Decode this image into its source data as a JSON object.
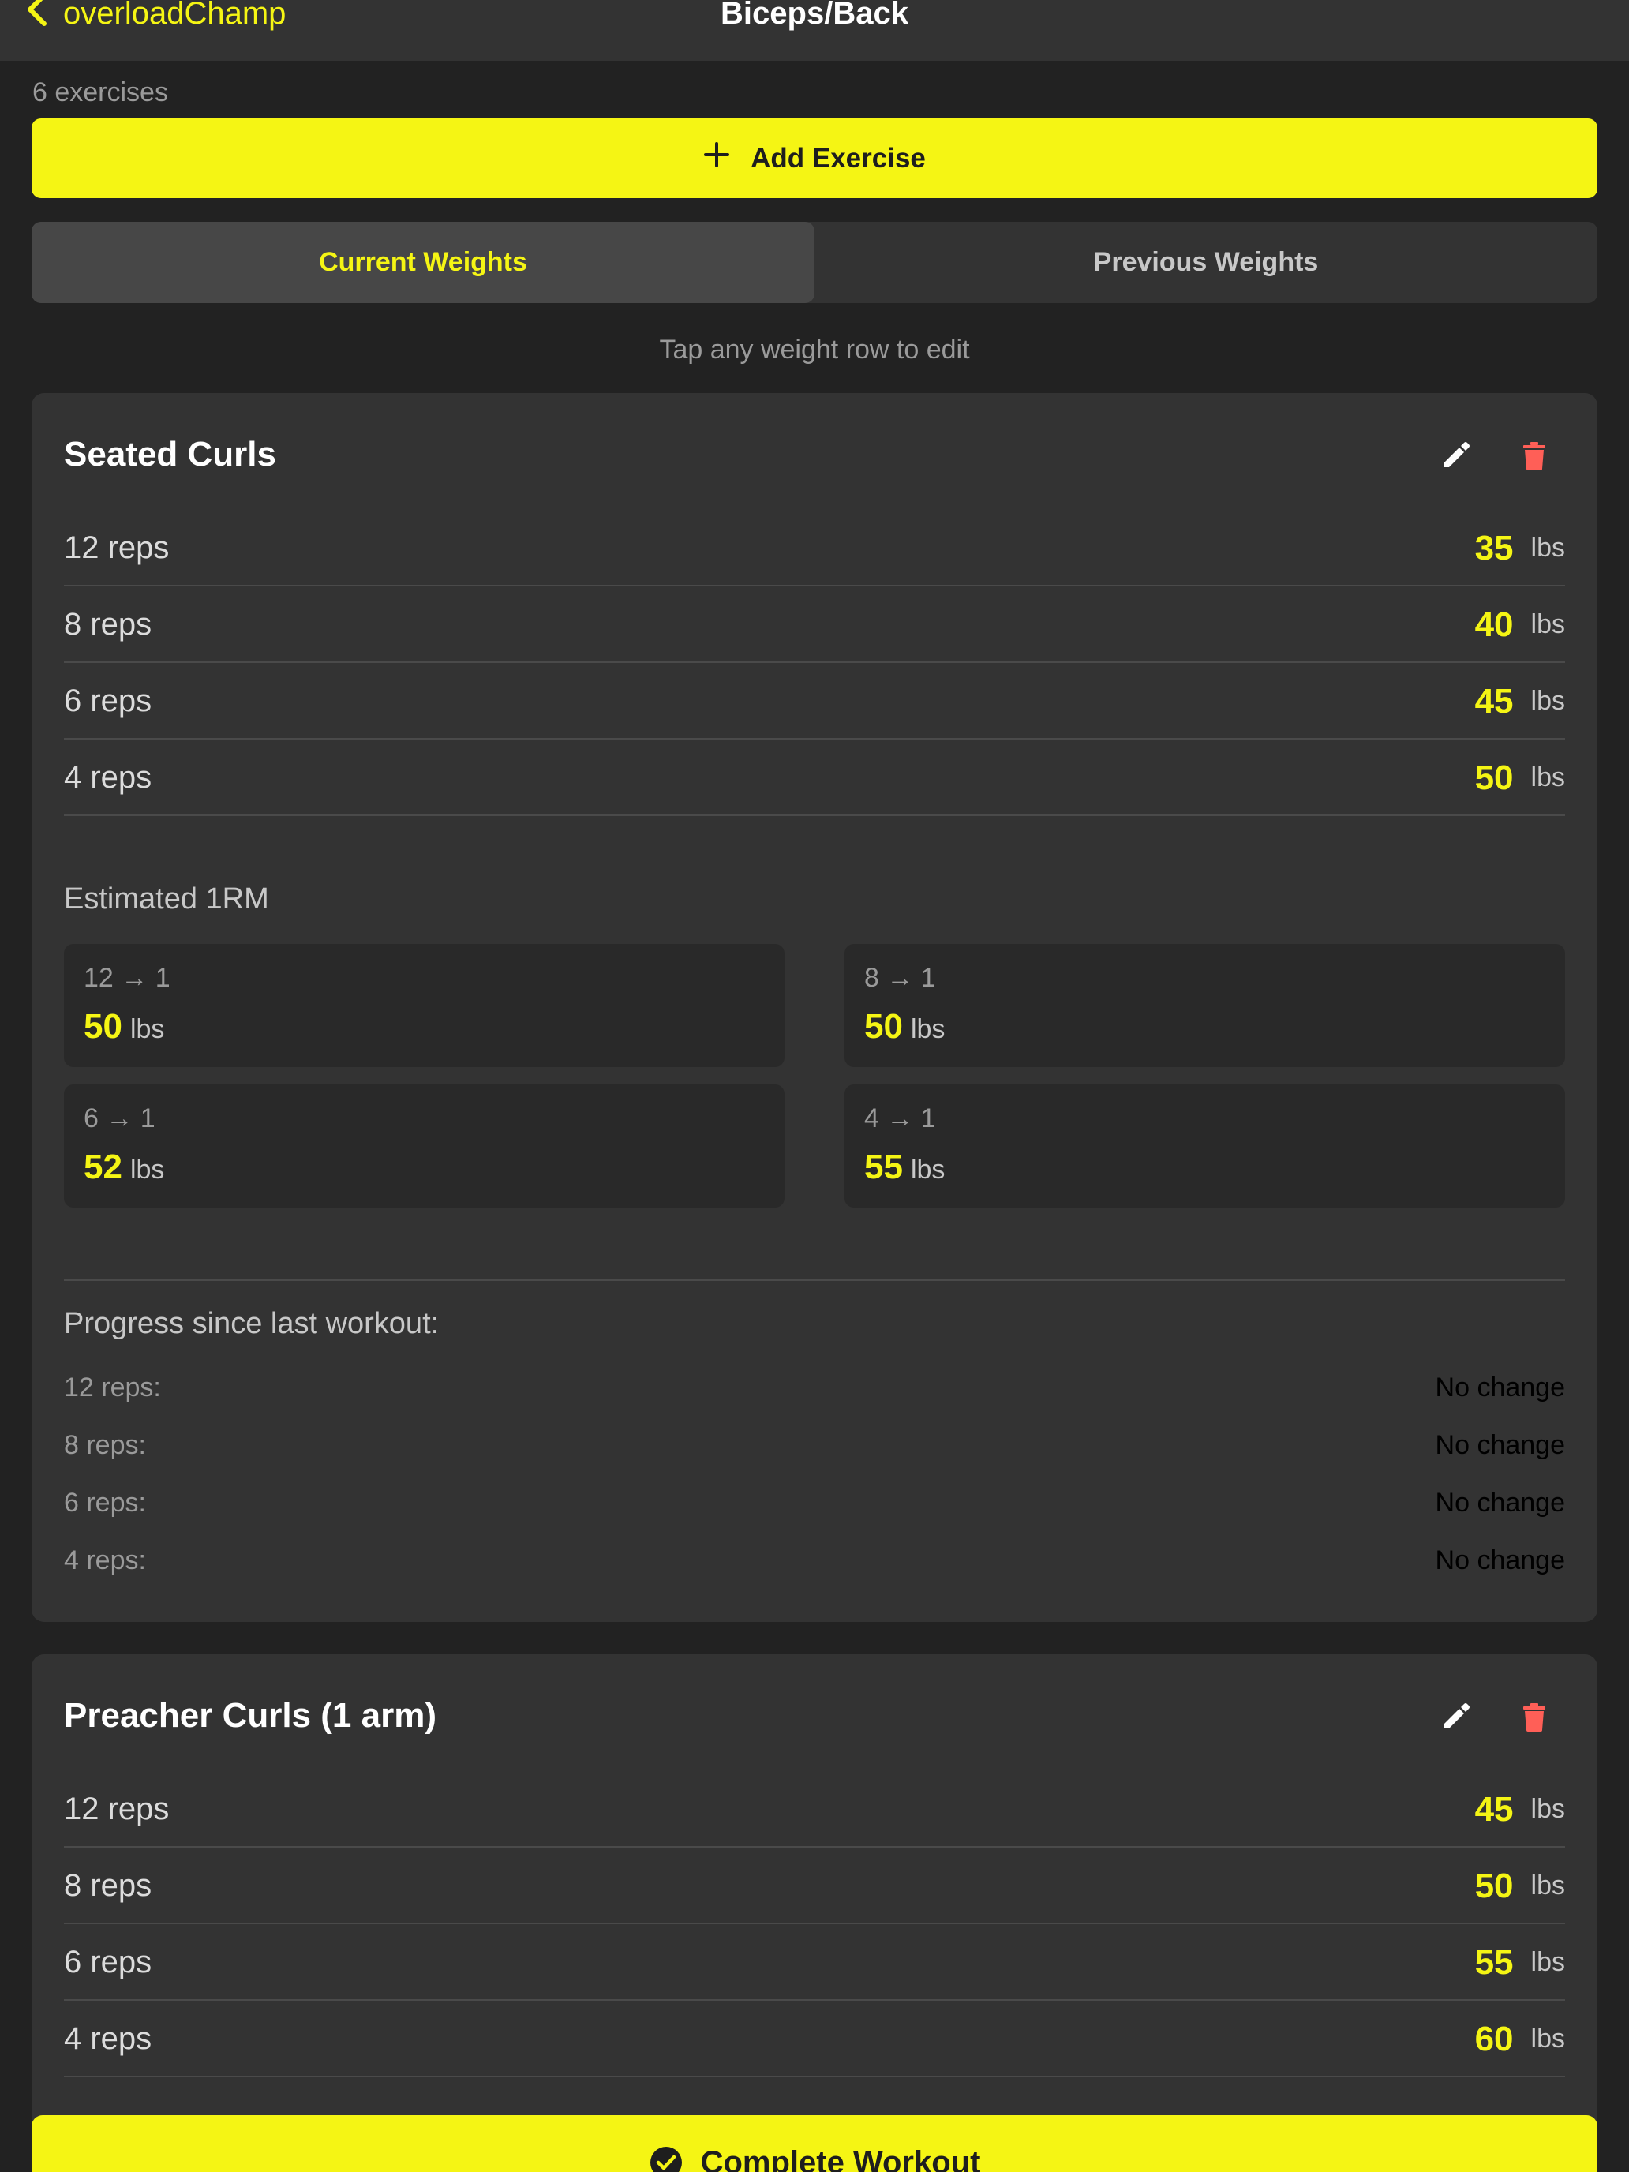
{
  "nav": {
    "back_label": "overloadChamp",
    "title": "Biceps/Back"
  },
  "exercise_count": "6 exercises",
  "add_exercise_label": "Add Exercise",
  "tabs": {
    "current": "Current Weights",
    "previous": "Previous Weights"
  },
  "hint": "Tap any weight row to edit",
  "unit": "lbs",
  "exercises": [
    {
      "name": "Seated Curls",
      "rows": [
        {
          "label": "12 reps",
          "value": "35"
        },
        {
          "label": "8 reps",
          "value": "40"
        },
        {
          "label": "6 reps",
          "value": "45"
        },
        {
          "label": "4 reps",
          "value": "50"
        }
      ],
      "one_rm_title": "Estimated 1RM",
      "one_rm": [
        {
          "label": "12 → 1",
          "value": "50"
        },
        {
          "label": "8 → 1",
          "value": "50"
        },
        {
          "label": "6 → 1",
          "value": "52"
        },
        {
          "label": "4 → 1",
          "value": "55"
        }
      ],
      "progress_title": "Progress since last workout:",
      "progress": [
        {
          "label": "12 reps:",
          "value": "No change"
        },
        {
          "label": "8 reps:",
          "value": "No change"
        },
        {
          "label": "6 reps:",
          "value": "No change"
        },
        {
          "label": "4 reps:",
          "value": "No change"
        }
      ]
    },
    {
      "name": "Preacher Curls (1 arm)",
      "rows": [
        {
          "label": "12 reps",
          "value": "45"
        },
        {
          "label": "8 reps",
          "value": "50"
        },
        {
          "label": "6 reps",
          "value": "55"
        },
        {
          "label": "4 reps",
          "value": "60"
        }
      ]
    }
  ],
  "complete_label": "Complete Workout",
  "colors": {
    "accent": "#f5f514",
    "delete": "#ff5f57",
    "background": "#222222",
    "card": "#333333"
  },
  "icons": {
    "back": "chevron-left-icon",
    "add": "plus-icon",
    "edit": "pencil-icon",
    "delete": "trash-icon",
    "complete": "checkmark-circle-icon"
  }
}
